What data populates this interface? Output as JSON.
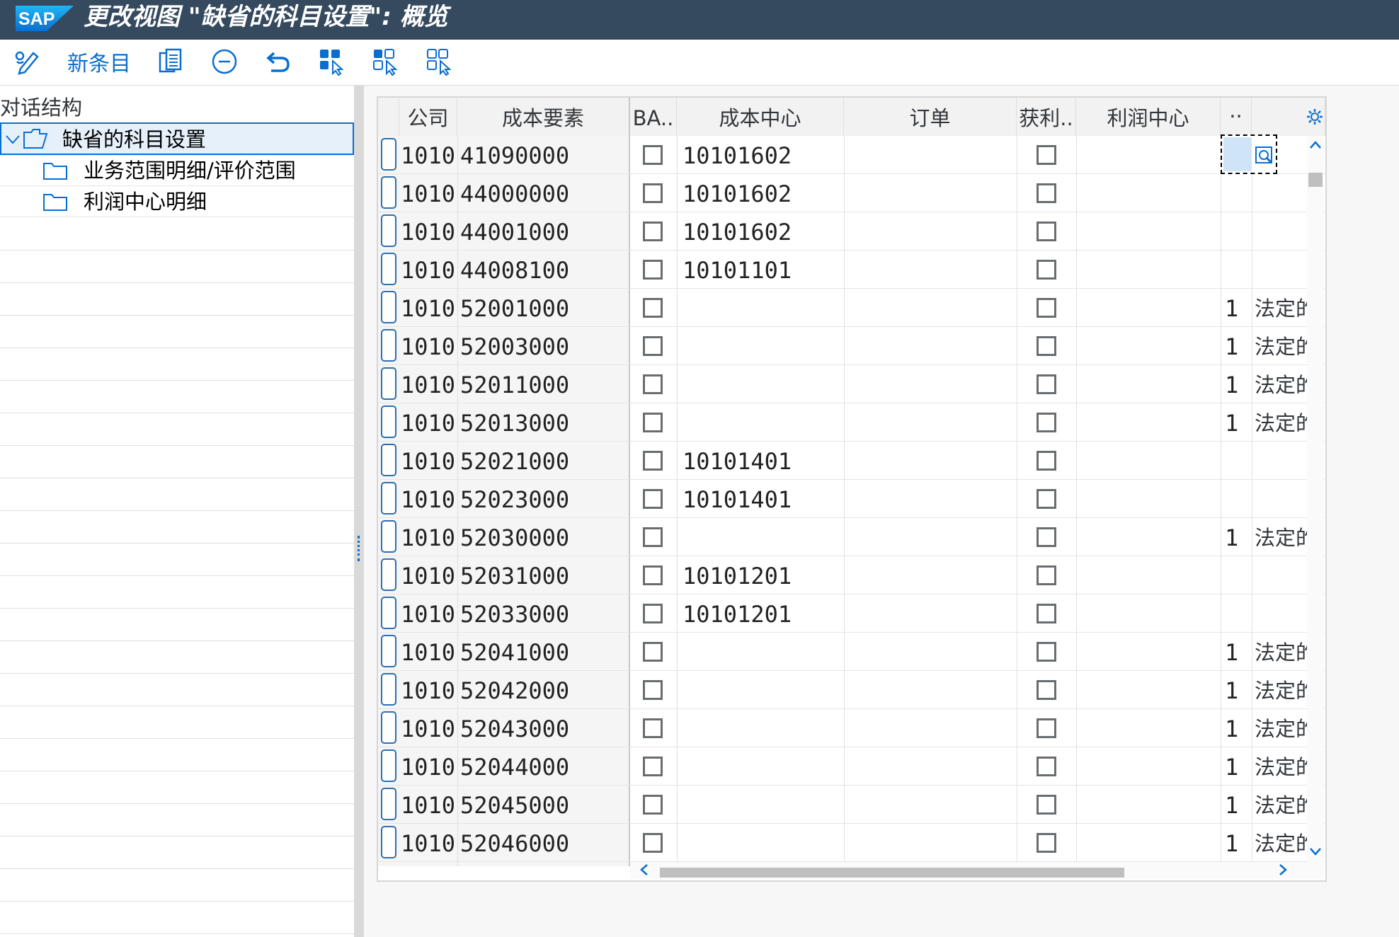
{
  "window": {
    "title": "更改视图 \"缺省的科目设置\": 概览",
    "logo_text": "SAP"
  },
  "toolbar": {
    "buttons": [
      {
        "name": "display-change-button",
        "icon": "pencil-glasses-icon"
      },
      {
        "name": "new-entries-button",
        "label": "新条目"
      },
      {
        "name": "copy-as-button",
        "icon": "copy-doc-icon"
      },
      {
        "name": "delete-button",
        "icon": "minus-circle-icon"
      },
      {
        "name": "undo-button",
        "icon": "undo-icon"
      },
      {
        "name": "select-all-button",
        "icon": "select-all-icon"
      },
      {
        "name": "select-block-button",
        "icon": "select-block-icon"
      },
      {
        "name": "deselect-all-button",
        "icon": "deselect-all-icon"
      }
    ]
  },
  "dialog_structure": {
    "heading": "对话结构",
    "nodes": [
      {
        "label": "缺省的科目设置",
        "level": 0,
        "expanded": true,
        "selected": true
      },
      {
        "label": "业务范围明细/评价范围",
        "level": 1
      },
      {
        "label": "利润中心明细",
        "level": 1
      }
    ]
  },
  "table": {
    "columns": [
      "公司",
      "成本要素",
      "BA..",
      "成本中心",
      "订单",
      "获利..",
      "利润中心",
      "..",
      ""
    ],
    "rows": [
      {
        "company": "1010",
        "cost_element": "41090000",
        "ba": false,
        "cost_center": "10101602",
        "order": "",
        "profit_seg": false,
        "profit_center": "",
        "flag": "",
        "text": ""
      },
      {
        "company": "1010",
        "cost_element": "44000000",
        "ba": false,
        "cost_center": "10101602",
        "order": "",
        "profit_seg": false,
        "profit_center": "",
        "flag": "",
        "text": ""
      },
      {
        "company": "1010",
        "cost_element": "44001000",
        "ba": false,
        "cost_center": "10101602",
        "order": "",
        "profit_seg": false,
        "profit_center": "",
        "flag": "",
        "text": ""
      },
      {
        "company": "1010",
        "cost_element": "44008100",
        "ba": false,
        "cost_center": "10101101",
        "order": "",
        "profit_seg": false,
        "profit_center": "",
        "flag": "",
        "text": ""
      },
      {
        "company": "1010",
        "cost_element": "52001000",
        "ba": false,
        "cost_center": "",
        "order": "",
        "profit_seg": false,
        "profit_center": "",
        "flag": "1",
        "text": "法定的"
      },
      {
        "company": "1010",
        "cost_element": "52003000",
        "ba": false,
        "cost_center": "",
        "order": "",
        "profit_seg": false,
        "profit_center": "",
        "flag": "1",
        "text": "法定的"
      },
      {
        "company": "1010",
        "cost_element": "52011000",
        "ba": false,
        "cost_center": "",
        "order": "",
        "profit_seg": false,
        "profit_center": "",
        "flag": "1",
        "text": "法定的"
      },
      {
        "company": "1010",
        "cost_element": "52013000",
        "ba": false,
        "cost_center": "",
        "order": "",
        "profit_seg": false,
        "profit_center": "",
        "flag": "1",
        "text": "法定的"
      },
      {
        "company": "1010",
        "cost_element": "52021000",
        "ba": false,
        "cost_center": "10101401",
        "order": "",
        "profit_seg": false,
        "profit_center": "",
        "flag": "",
        "text": ""
      },
      {
        "company": "1010",
        "cost_element": "52023000",
        "ba": false,
        "cost_center": "10101401",
        "order": "",
        "profit_seg": false,
        "profit_center": "",
        "flag": "",
        "text": ""
      },
      {
        "company": "1010",
        "cost_element": "52030000",
        "ba": false,
        "cost_center": "",
        "order": "",
        "profit_seg": false,
        "profit_center": "",
        "flag": "1",
        "text": "法定的"
      },
      {
        "company": "1010",
        "cost_element": "52031000",
        "ba": false,
        "cost_center": "10101201",
        "order": "",
        "profit_seg": false,
        "profit_center": "",
        "flag": "",
        "text": ""
      },
      {
        "company": "1010",
        "cost_element": "52033000",
        "ba": false,
        "cost_center": "10101201",
        "order": "",
        "profit_seg": false,
        "profit_center": "",
        "flag": "",
        "text": ""
      },
      {
        "company": "1010",
        "cost_element": "52041000",
        "ba": false,
        "cost_center": "",
        "order": "",
        "profit_seg": false,
        "profit_center": "",
        "flag": "1",
        "text": "法定的"
      },
      {
        "company": "1010",
        "cost_element": "52042000",
        "ba": false,
        "cost_center": "",
        "order": "",
        "profit_seg": false,
        "profit_center": "",
        "flag": "1",
        "text": "法定的"
      },
      {
        "company": "1010",
        "cost_element": "52043000",
        "ba": false,
        "cost_center": "",
        "order": "",
        "profit_seg": false,
        "profit_center": "",
        "flag": "1",
        "text": "法定的"
      },
      {
        "company": "1010",
        "cost_element": "52044000",
        "ba": false,
        "cost_center": "",
        "order": "",
        "profit_seg": false,
        "profit_center": "",
        "flag": "1",
        "text": "法定的"
      },
      {
        "company": "1010",
        "cost_element": "52045000",
        "ba": false,
        "cost_center": "",
        "order": "",
        "profit_seg": false,
        "profit_center": "",
        "flag": "1",
        "text": "法定的"
      },
      {
        "company": "1010",
        "cost_element": "52046000",
        "ba": false,
        "cost_center": "",
        "order": "",
        "profit_seg": false,
        "profit_center": "",
        "flag": "1",
        "text": "法定的"
      }
    ]
  },
  "colors": {
    "title_bar": "#354a5f",
    "accent": "#0a6ed1",
    "selection": "#e5f0fa",
    "focus_fill": "#cfe4f7"
  }
}
